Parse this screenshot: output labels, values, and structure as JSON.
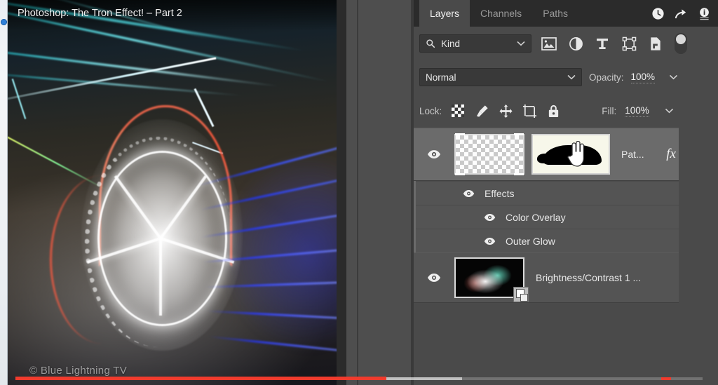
{
  "video": {
    "title": "Photoshop: The Tron Effect! – Part 2",
    "watermark": "© Blue Lightning TV",
    "progress": {
      "played_pct": 54,
      "buffered_pct": 65,
      "chapter_mark_pct": 94
    },
    "accent_color": "#f03b2d"
  },
  "panel": {
    "tabs": [
      {
        "label": "Layers",
        "active": true
      },
      {
        "label": "Channels",
        "active": false
      },
      {
        "label": "Paths",
        "active": false
      }
    ],
    "header_icons": [
      {
        "name": "history-icon"
      },
      {
        "name": "share-icon"
      },
      {
        "name": "info-icon"
      }
    ],
    "filter": {
      "search_icon": "search-icon",
      "kind_value": "Kind",
      "icons": [
        "filter-pixel-icon",
        "filter-adjustment-icon",
        "filter-type-icon",
        "filter-shape-icon",
        "filter-smartobject-icon"
      ],
      "toggle": "filter-enable-toggle"
    },
    "blend": {
      "mode": "Normal",
      "opacity_label": "Opacity:",
      "opacity_value": "100%"
    },
    "lock": {
      "label": "Lock:",
      "icons": [
        "lock-transparency-icon",
        "lock-image-pixels-icon",
        "lock-position-icon",
        "lock-artboard-icon",
        "lock-all-icon"
      ],
      "fill_label": "Fill:",
      "fill_value": "100%"
    },
    "layers": [
      {
        "name": "Pat...",
        "visible": true,
        "selected": true,
        "has_fx": true,
        "fx_label": "fx",
        "thumbnail": "transparent-checker",
        "mask_thumbnail": "car-silhouette-mask",
        "effects": [
          {
            "label": "Effects",
            "visible": true,
            "level": 0
          },
          {
            "label": "Color Overlay",
            "visible": true,
            "level": 1
          },
          {
            "label": "Outer Glow",
            "visible": true,
            "level": 1
          }
        ]
      },
      {
        "name": "Brightness/Contrast 1 ...",
        "visible": true,
        "selected": false,
        "has_fx": false,
        "thumbnail": "car-photo",
        "badge": "smart-object-badge"
      }
    ]
  },
  "colors": {
    "panel_bg": "#4a4a4a",
    "row_bg": "#545454",
    "row_selected_bg": "#6b6b6b",
    "tabbar_bg": "#2b2b2b",
    "text": "#eaeaea"
  }
}
